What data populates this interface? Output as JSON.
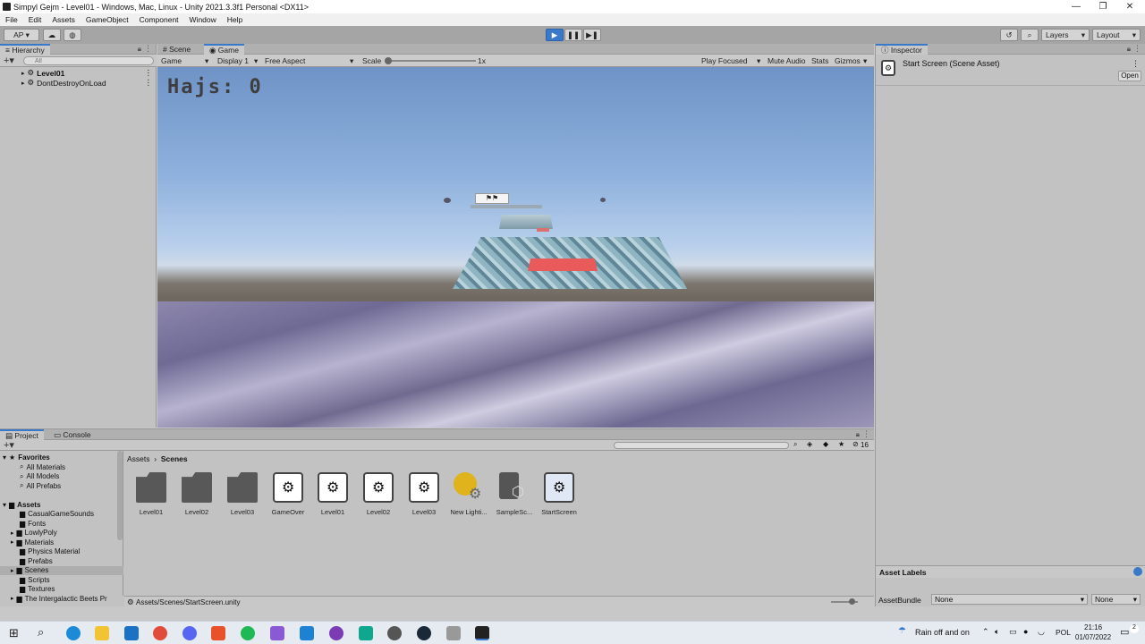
{
  "window": {
    "title": "Simpyl Gejm - Level01 - Windows, Mac, Linux - Unity 2021.3.3f1 Personal <DX11>",
    "controls": [
      "—",
      "❐",
      "✕"
    ]
  },
  "menu": [
    "File",
    "Edit",
    "Assets",
    "GameObject",
    "Component",
    "Window",
    "Help"
  ],
  "toolbar": {
    "account": "AP ▾",
    "layers": "Layers",
    "layout": "Layout"
  },
  "hierarchy": {
    "tab": "Hierarchy",
    "search_placeholder": "All",
    "items": [
      {
        "label": "Level01"
      },
      {
        "label": "DontDestroyOnLoad"
      }
    ]
  },
  "game": {
    "tabs": [
      "Scene",
      "Game"
    ],
    "controls": {
      "mode": "Game",
      "display": "Display 1",
      "aspect": "Free Aspect",
      "scale_label": "Scale",
      "scale_value": "1x",
      "play_focused": "Play Focused",
      "mute_audio": "Mute Audio",
      "stats": "Stats",
      "gizmos": "Gizmos"
    },
    "hud": "Hajs: 0"
  },
  "inspector": {
    "tab": "Inspector",
    "object": "Start Screen (Scene Asset)",
    "open_button": "Open",
    "asset_labels": "Asset Labels",
    "asset_bundle_label": "AssetBundle",
    "asset_bundle_value": "None",
    "variant_value": "None"
  },
  "project": {
    "tabs": [
      "Project",
      "Console"
    ],
    "breadcrumb": [
      "Assets",
      "Scenes"
    ],
    "hidden_count": "16",
    "favorites_header": "Favorites",
    "favorites": [
      "All Materials",
      "All Models",
      "All Prefabs"
    ],
    "assets_header": "Assets",
    "tree": [
      "CasualGameSounds",
      "Fonts",
      "LowlyPoly",
      "Materials",
      "Physics Material",
      "Prefabs",
      "Scenes",
      "Scripts",
      "Textures",
      "The Intergalactic Beets Pr"
    ],
    "selected_tree": "Scenes",
    "items": [
      {
        "label": "Level01",
        "kind": "folder"
      },
      {
        "label": "Level02",
        "kind": "folder"
      },
      {
        "label": "Level03",
        "kind": "folder"
      },
      {
        "label": "GameOver",
        "kind": "scene"
      },
      {
        "label": "Level01",
        "kind": "scene"
      },
      {
        "label": "Level02",
        "kind": "scene"
      },
      {
        "label": "Level03",
        "kind": "scene"
      },
      {
        "label": "New Lighti...",
        "kind": "lighting"
      },
      {
        "label": "SampleSc...",
        "kind": "sample"
      },
      {
        "label": "StartScreen",
        "kind": "scene"
      }
    ],
    "status_path": "Assets/Scenes/StartScreen.unity"
  },
  "taskbar": {
    "weather": "Rain off and on",
    "language": "POL",
    "time": "21:16",
    "date": "01/07/2022",
    "notifications": "2"
  }
}
